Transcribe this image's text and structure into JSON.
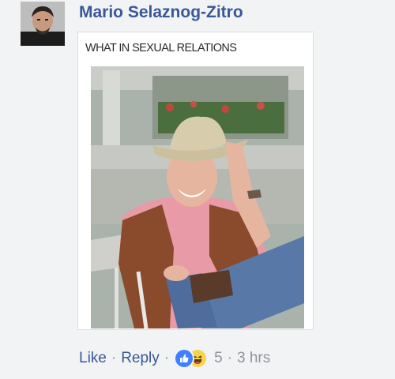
{
  "comment": {
    "author": "Mario Selaznog-Zitro",
    "avatar_icon": "profile-photo",
    "attachment": {
      "caption": "WHAT IN SEXUAL RELATIONS",
      "image_icon": "photo-man-in-cowboy-hat"
    },
    "actions": {
      "like_label": "Like",
      "reply_label": "Reply",
      "separator": "·",
      "reaction_icons": [
        "like-reaction-icon",
        "haha-reaction-icon"
      ],
      "reaction_count": "5",
      "timestamp": "3 hrs"
    }
  },
  "colors": {
    "link": "#385898",
    "meta": "#90949c",
    "background": "#f2f3f5",
    "like_blue": "#4080ff",
    "haha_yellow": "#f7d54a"
  }
}
